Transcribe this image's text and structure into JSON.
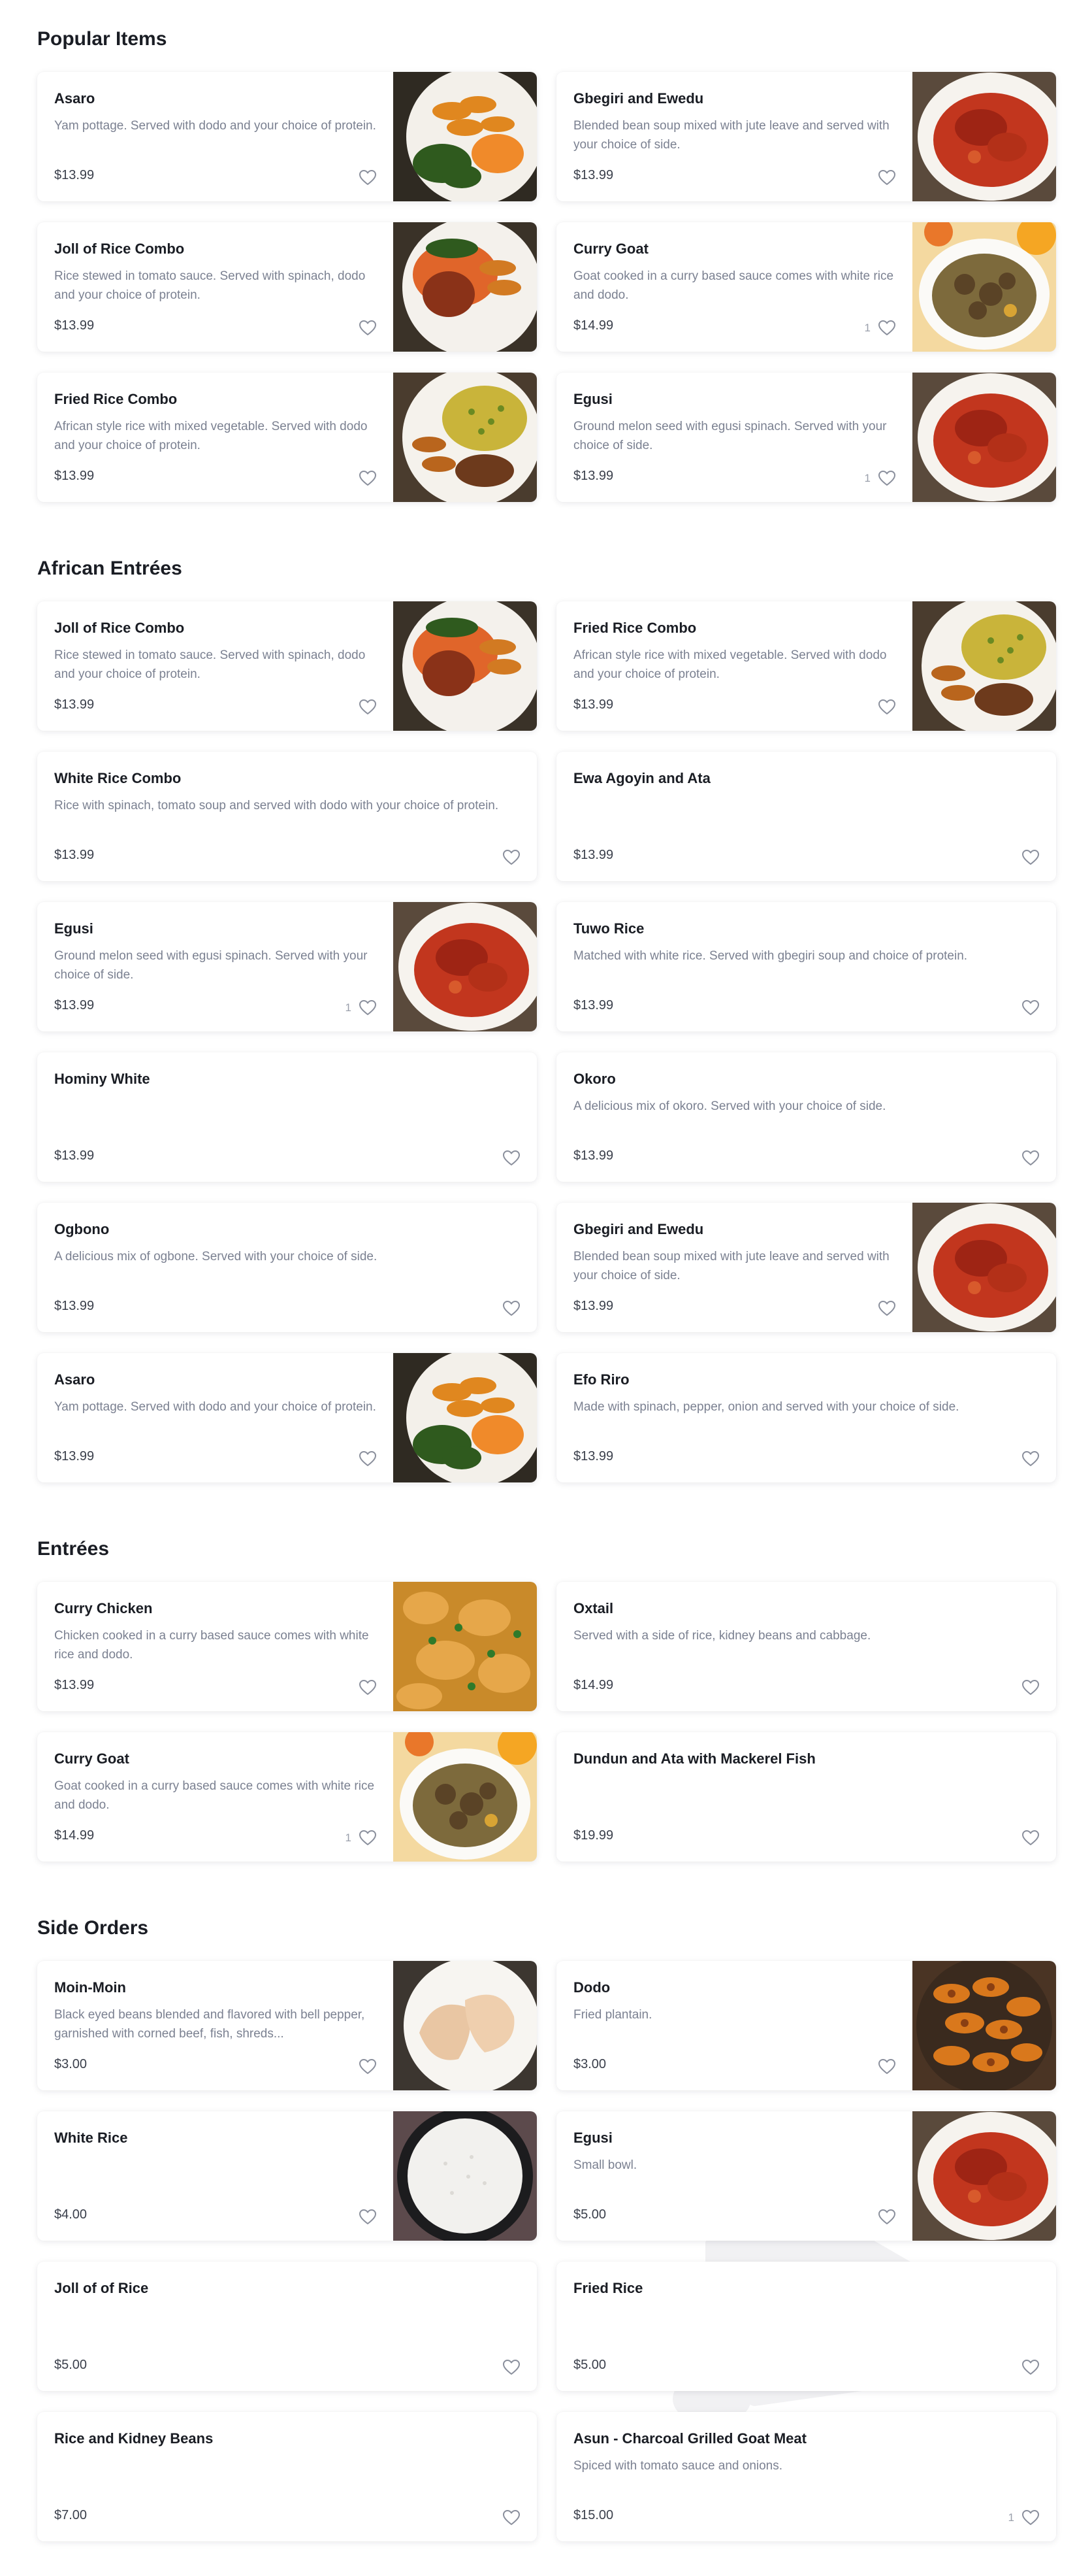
{
  "sections": [
    {
      "title": "Popular Items",
      "items": [
        {
          "name": "Asaro",
          "desc": "Yam pottage. Served with dodo and your choice of protein.",
          "price": "$13.99",
          "likes": "",
          "image": "plantain-yam"
        },
        {
          "name": "Gbegiri and Ewedu",
          "desc": "Blended bean soup mixed with jute leave and served with your choice of side.",
          "price": "$13.99",
          "likes": "",
          "image": "red-stew"
        },
        {
          "name": "Joll of Rice Combo",
          "desc": "Rice stewed in tomato sauce. Served with spinach, dodo and your choice of protein.",
          "price": "$13.99",
          "likes": "",
          "image": "jollof"
        },
        {
          "name": "Curry Goat",
          "desc": "Goat cooked in a curry based sauce comes with white rice and dodo.",
          "price": "$14.99",
          "likes": "1",
          "image": "curry-goat"
        },
        {
          "name": "Fried Rice Combo",
          "desc": "African style rice with mixed vegetable. Served with dodo and your choice of protein.",
          "price": "$13.99",
          "likes": "",
          "image": "fried-rice"
        },
        {
          "name": "Egusi",
          "desc": "Ground melon seed with egusi spinach. Served with your choice of side.",
          "price": "$13.99",
          "likes": "1",
          "image": "red-stew"
        }
      ]
    },
    {
      "title": "African Entrées",
      "items": [
        {
          "name": "Joll of Rice Combo",
          "desc": "Rice stewed in tomato sauce. Served with spinach, dodo and your choice of protein.",
          "price": "$13.99",
          "likes": "",
          "image": "jollof"
        },
        {
          "name": "Fried Rice Combo",
          "desc": "African style rice with mixed vegetable. Served with dodo and your choice of protein.",
          "price": "$13.99",
          "likes": "",
          "image": "fried-rice"
        },
        {
          "name": "White Rice Combo",
          "desc": "Rice with spinach, tomato soup and served with dodo with your choice of protein.",
          "price": "$13.99",
          "likes": "",
          "image": ""
        },
        {
          "name": "Ewa Agoyin and Ata",
          "desc": "",
          "price": "$13.99",
          "likes": "",
          "image": ""
        },
        {
          "name": "Egusi",
          "desc": "Ground melon seed with egusi spinach. Served with your choice of side.",
          "price": "$13.99",
          "likes": "1",
          "image": "red-stew"
        },
        {
          "name": "Tuwo Rice",
          "desc": "Matched with white rice. Served with gbegiri soup and choice of protein.",
          "price": "$13.99",
          "likes": "",
          "image": ""
        },
        {
          "name": "Hominy White",
          "desc": "",
          "price": "$13.99",
          "likes": "",
          "image": ""
        },
        {
          "name": "Okoro",
          "desc": "A delicious mix of okoro. Served with your choice of side.",
          "price": "$13.99",
          "likes": "",
          "image": ""
        },
        {
          "name": "Ogbono",
          "desc": "A delicious mix of ogbone. Served with your choice of side.",
          "price": "$13.99",
          "likes": "",
          "image": ""
        },
        {
          "name": "Gbegiri and Ewedu",
          "desc": "Blended bean soup mixed with jute leave and served with your choice of side.",
          "price": "$13.99",
          "likes": "",
          "image": "red-stew"
        },
        {
          "name": "Asaro",
          "desc": "Yam pottage. Served with dodo and your choice of protein.",
          "price": "$13.99",
          "likes": "",
          "image": "plantain-yam"
        },
        {
          "name": "Efo Riro",
          "desc": "Made with spinach, pepper, onion and served with your choice of side.",
          "price": "$13.99",
          "likes": "",
          "image": ""
        }
      ]
    },
    {
      "title": "Entrées",
      "items": [
        {
          "name": "Curry Chicken",
          "desc": "Chicken cooked in a curry based sauce comes with white rice and dodo.",
          "price": "$13.99",
          "likes": "",
          "image": "curry-chicken"
        },
        {
          "name": "Oxtail",
          "desc": "Served with a side of rice, kidney beans and cabbage.",
          "price": "$14.99",
          "likes": "",
          "image": ""
        },
        {
          "name": "Curry Goat",
          "desc": "Goat cooked in a curry based sauce comes with white rice and dodo.",
          "price": "$14.99",
          "likes": "1",
          "image": "curry-goat"
        },
        {
          "name": "Dundun and Ata with Mackerel Fish",
          "desc": "",
          "price": "$19.99",
          "likes": "",
          "image": ""
        }
      ]
    },
    {
      "title": "Side Orders",
      "items": [
        {
          "name": "Moin-Moin",
          "desc": "Black eyed beans blended and flavored with bell pepper, garnished with corned beef, fish, shreds...",
          "price": "$3.00",
          "likes": "",
          "image": "moin-moin"
        },
        {
          "name": "Dodo",
          "desc": "Fried plantain.",
          "price": "$3.00",
          "likes": "",
          "image": "dodo"
        },
        {
          "name": "White Rice",
          "desc": "",
          "price": "$4.00",
          "likes": "",
          "image": "white-rice"
        },
        {
          "name": "Egusi",
          "desc": "Small bowl.",
          "price": "$5.00",
          "likes": "",
          "image": "red-stew"
        },
        {
          "name": "Joll of of Rice",
          "desc": "",
          "price": "$5.00",
          "likes": "",
          "image": ""
        },
        {
          "name": "Fried Rice",
          "desc": "",
          "price": "$5.00",
          "likes": "",
          "image": ""
        },
        {
          "name": "Rice and Kidney Beans",
          "desc": "",
          "price": "$7.00",
          "likes": "",
          "image": ""
        },
        {
          "name": "Asun - Charcoal Grilled Goat Meat",
          "desc": "Spiced with tomato sauce and onions.",
          "price": "$15.00",
          "likes": "1",
          "image": ""
        }
      ]
    }
  ],
  "watermark": {
    "text": "sirved"
  },
  "colors": {
    "heart": "#8a8f9c",
    "price": "#3a3f4b",
    "desc": "#7b8191"
  }
}
